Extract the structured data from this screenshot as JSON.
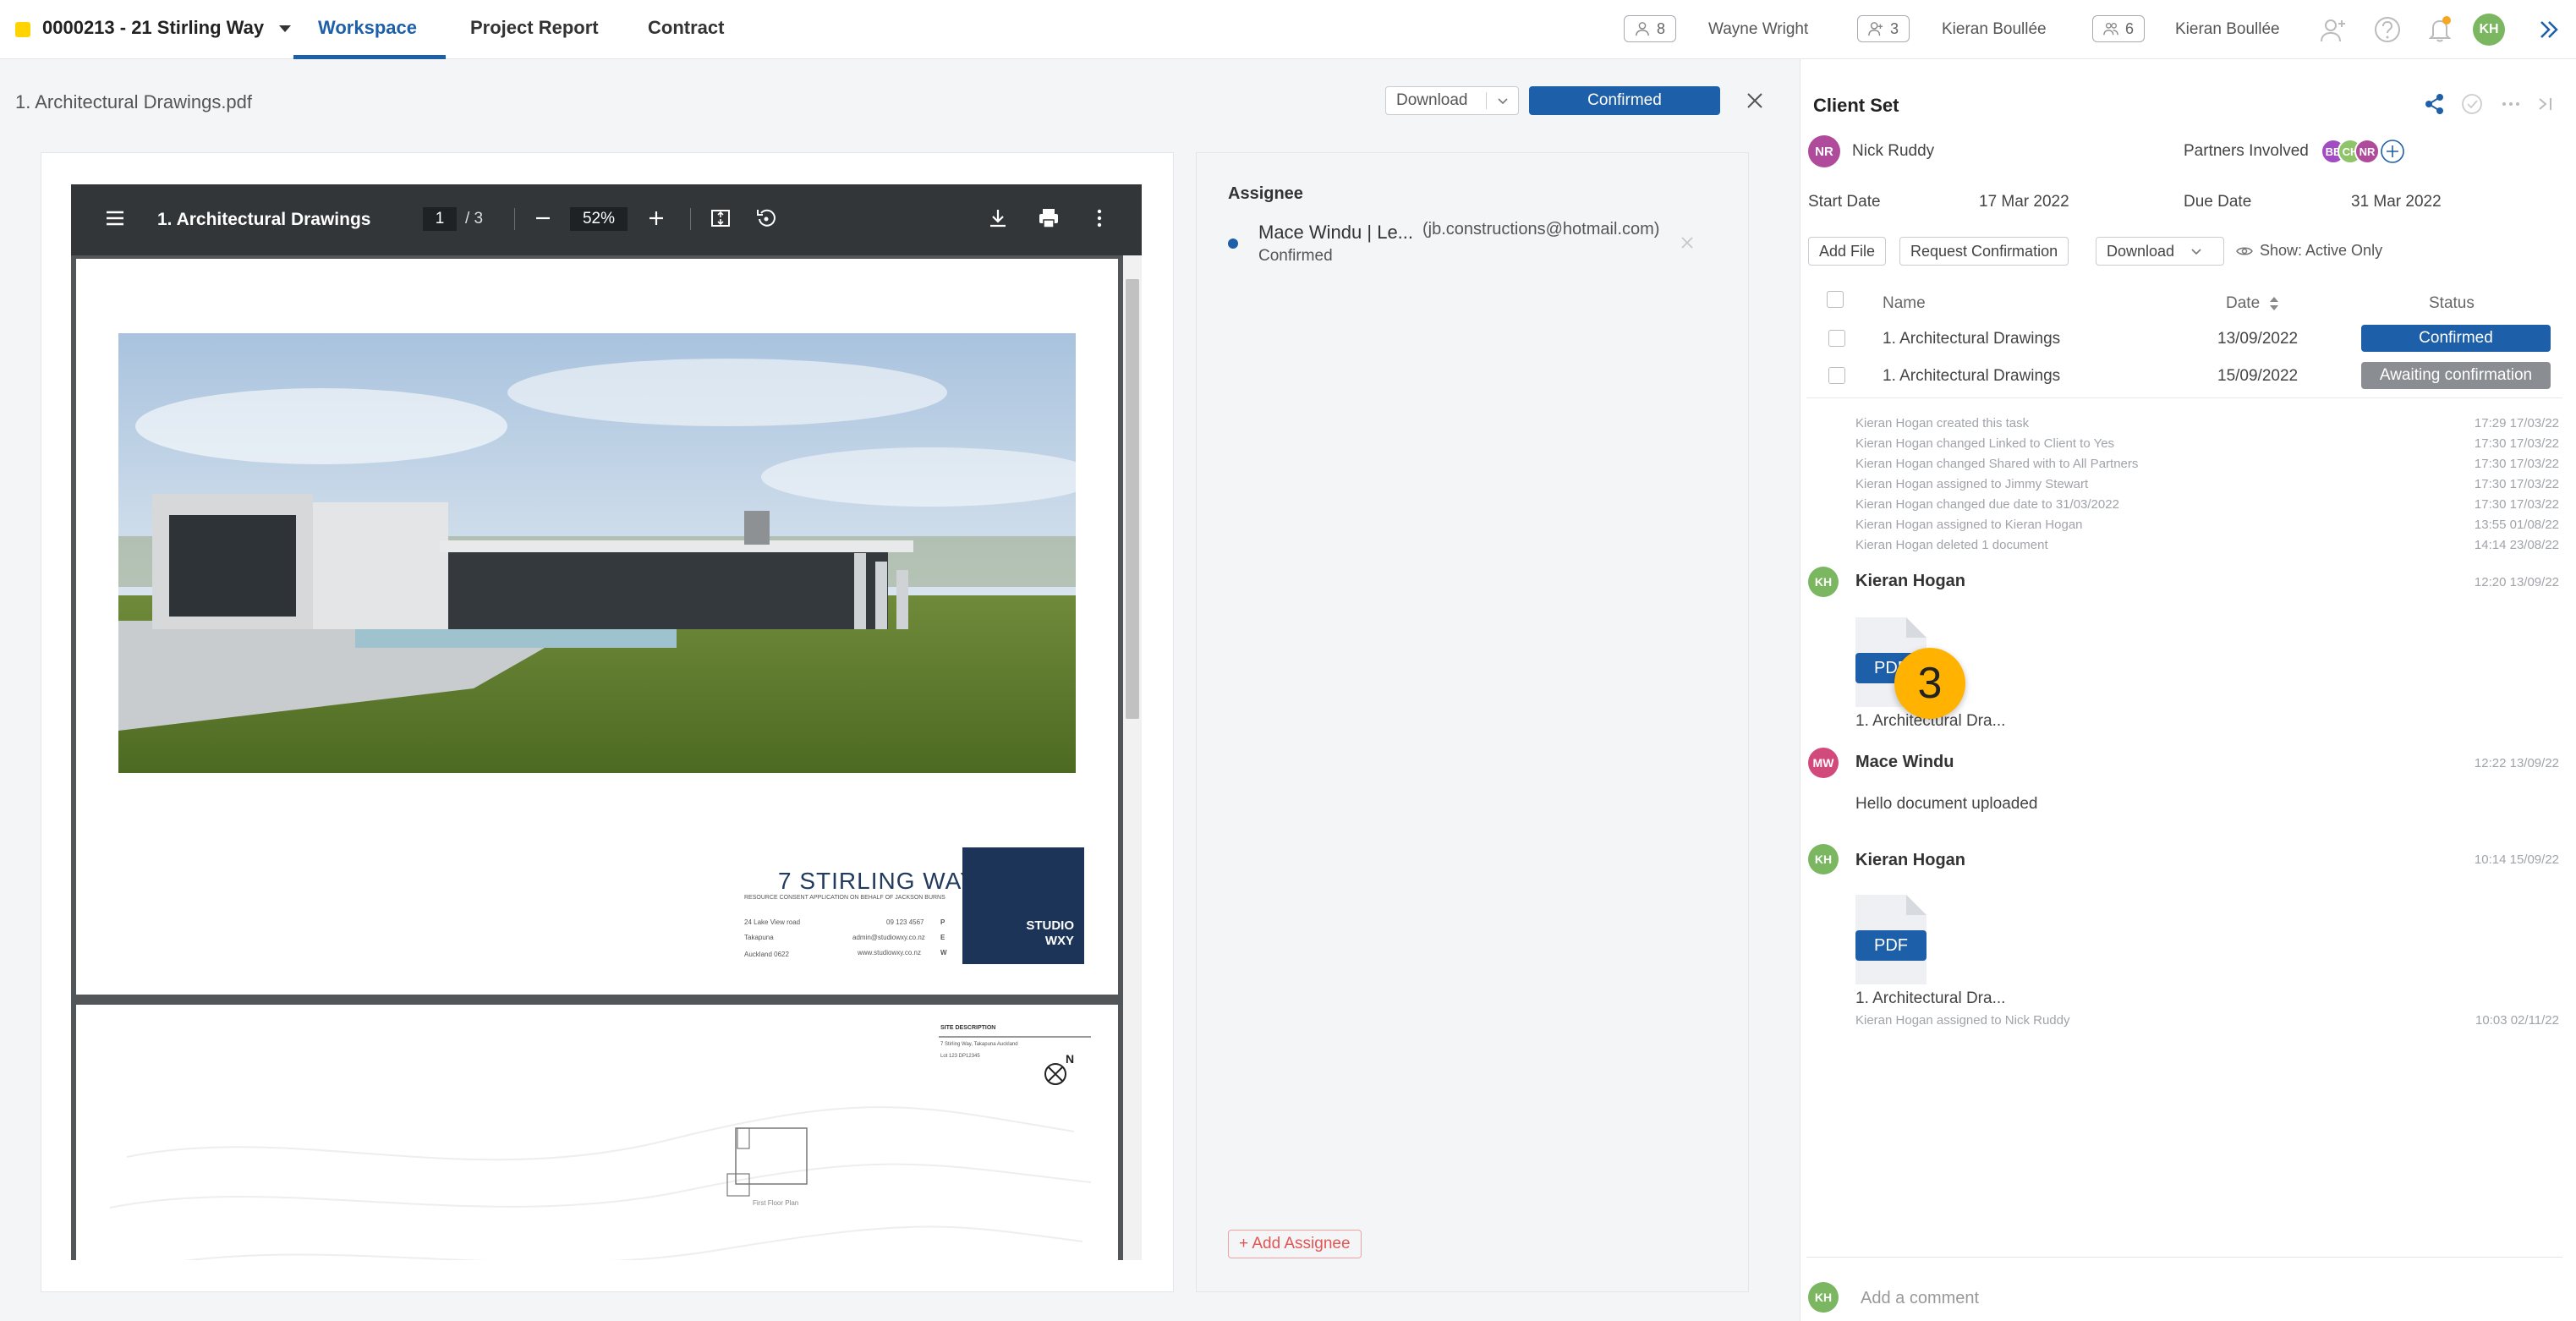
{
  "project": {
    "name": "0000213 - 21 Stirling Way"
  },
  "tabs": [
    {
      "label": "Workspace"
    },
    {
      "label": "Project Report"
    },
    {
      "label": "Contract"
    }
  ],
  "header_chips": [
    {
      "count": "8",
      "user": "Wayne Wright"
    },
    {
      "count": "3",
      "user": "Kieran Boullée"
    },
    {
      "count": "6",
      "user": "Kieran Boullée"
    }
  ],
  "current_user": {
    "initials": "KH",
    "color": "#7bb661"
  },
  "document": {
    "title": "1. Architectural Drawings.pdf",
    "download_label": "Download",
    "confirmed_label": "Confirmed"
  },
  "pdf_viewer": {
    "title": "1. Architectural Drawings",
    "page": "1",
    "page_of": "/  3",
    "zoom": "52%"
  },
  "pdf_page1": {
    "heading": "7 STIRLING WAY",
    "subheading": "RESOURCE CONSENT APPLICATION ON BEHALF OF JACKSON BURNS",
    "addr1": "24 Lake View road",
    "addr2": "Takapuna",
    "addr3": "Auckland 0622",
    "phone": "09 123 4567",
    "email": "admin@studiowxy.co.nz",
    "web": "www.studiowxy.co.nz",
    "phone_tag": "P",
    "email_tag": "E",
    "web_tag": "W",
    "studio_line1": "STUDIO",
    "studio_line2": "WXY"
  },
  "pdf_page2": {
    "site_heading": "SITE DESCRIPTION",
    "site_line1": "7 Stirling Way, Takapuna Auckland",
    "site_line2": "Lot 123 DP12345",
    "north": "N",
    "floor_label": "First Floor Plan"
  },
  "assignee": {
    "heading": "Assignee",
    "name": "Mace Windu | Le...",
    "email": "(jb.constructions@hotmail.com)",
    "status": "Confirmed",
    "add_label": "+ Add Assignee"
  },
  "right_panel": {
    "title": "Client Set",
    "owner": {
      "initials": "NR",
      "name": "Nick Ruddy",
      "color": "#b04a9a"
    },
    "partners_label": "Partners Involved",
    "partners": [
      {
        "initials": "BB",
        "color": "#a24cc2"
      },
      {
        "initials": "CH",
        "color": "#8fc46a"
      },
      {
        "initials": "NR",
        "color": "#b04a9a"
      }
    ],
    "start_label": "Start Date",
    "start_value": "17 Mar 2022",
    "due_label": "Due Date",
    "due_value": "31 Mar 2022",
    "add_file_label": "Add File",
    "request_label": "Request Confirmation",
    "download_label": "Download",
    "show_label": "Show: Active Only",
    "columns": {
      "name": "Name",
      "date": "Date",
      "status": "Status"
    },
    "files": [
      {
        "name": "1. Architectural Drawings",
        "date": "13/09/2022",
        "status": "Confirmed",
        "status_color": "#1d5fa8"
      },
      {
        "name": "1. Architectural Drawings",
        "date": "15/09/2022",
        "status": "Awaiting confirmation",
        "status_color": "#8a8d91"
      }
    ],
    "activity": [
      {
        "text": "Kieran Hogan created this task",
        "time": "17:29 17/03/22"
      },
      {
        "text": "Kieran Hogan changed Linked to Client to Yes",
        "time": "17:30 17/03/22"
      },
      {
        "text": "Kieran Hogan changed Shared with to All Partners",
        "time": "17:30 17/03/22"
      },
      {
        "text": "Kieran Hogan assigned to Jimmy Stewart",
        "time": "17:30 17/03/22"
      },
      {
        "text": "Kieran Hogan changed due date to 31/03/2022",
        "time": "17:30 17/03/22"
      },
      {
        "text": "Kieran Hogan assigned to Kieran Hogan",
        "time": "13:55 01/08/22"
      },
      {
        "text": "Kieran Hogan deleted 1 document",
        "time": "14:14 23/08/22"
      }
    ],
    "comments": [
      {
        "initials": "KH",
        "color": "#7bb661",
        "name": "Kieran Hogan",
        "time": "12:20 13/09/22",
        "file": "1. Architectural Dra...",
        "pdf_label": "PDF"
      },
      {
        "initials": "MW",
        "color": "#d24a7c",
        "name": "Mace Windu",
        "time": "12:22 13/09/22",
        "text": "Hello document uploaded"
      },
      {
        "initials": "KH",
        "color": "#7bb661",
        "name": "Kieran Hogan",
        "time": "10:14 15/09/22",
        "file": "1. Architectural Dra...",
        "pdf_label": "PDF"
      }
    ],
    "last_activity": {
      "text": "Kieran Hogan assigned to Nick Ruddy",
      "time": "10:03 02/11/22"
    },
    "badge": "3",
    "comment_placeholder": "Add a comment"
  }
}
